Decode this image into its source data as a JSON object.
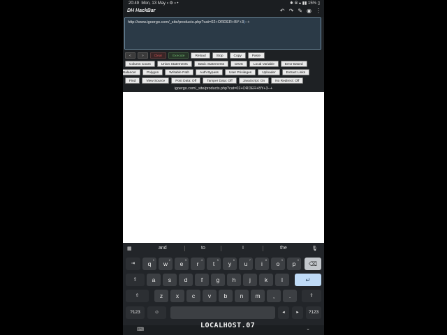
{
  "status": {
    "time": "20:49",
    "date": "Mon, 13 May",
    "battery": "15%"
  },
  "app": {
    "title": "DH HackBar"
  },
  "url": {
    "text": "http://www.igoergo.com/_site/products.php?cat=02+ORDER+BY+3",
    "tail": "--+"
  },
  "buttons_row1": [
    "<",
    ">",
    "Clear",
    "Execute",
    "Reload",
    "Stop",
    "Copy",
    "Paste"
  ],
  "buttons_row2": [
    "Column Count",
    "Union Statements",
    "Basic Statements",
    "DIOS",
    "Local Variable",
    "Error Based"
  ],
  "buttons_row3": [
    "Balancer",
    "Polygon",
    "Writable Path",
    "Auth Bypass",
    "User Privileges",
    "Uploader",
    "Extract Links"
  ],
  "buttons_row4": [
    "Find",
    "View Source",
    "Post Data: Off",
    "Tamper Data: Off",
    "JavaScript: On",
    "No Redirect: Off"
  ],
  "url_preview": "igoergo.com/_site/products.php?cat=02+ORDER+BY+3--+",
  "suggestions": [
    "and",
    "to",
    "I",
    "the"
  ],
  "keyboard": {
    "row1": [
      "q",
      "w",
      "e",
      "r",
      "t",
      "y",
      "u",
      "i",
      "o",
      "p"
    ],
    "row1_digits": [
      "1",
      "2",
      "3",
      "4",
      "5",
      "6",
      "7",
      "8",
      "9",
      "0"
    ],
    "row2": [
      "a",
      "s",
      "d",
      "f",
      "g",
      "h",
      "j",
      "k",
      "l"
    ],
    "row3": [
      "z",
      "x",
      "c",
      "v",
      "b",
      "n",
      "m",
      ",",
      "."
    ],
    "sym_label": "?123"
  },
  "watermark": "LOCALHOST.07"
}
